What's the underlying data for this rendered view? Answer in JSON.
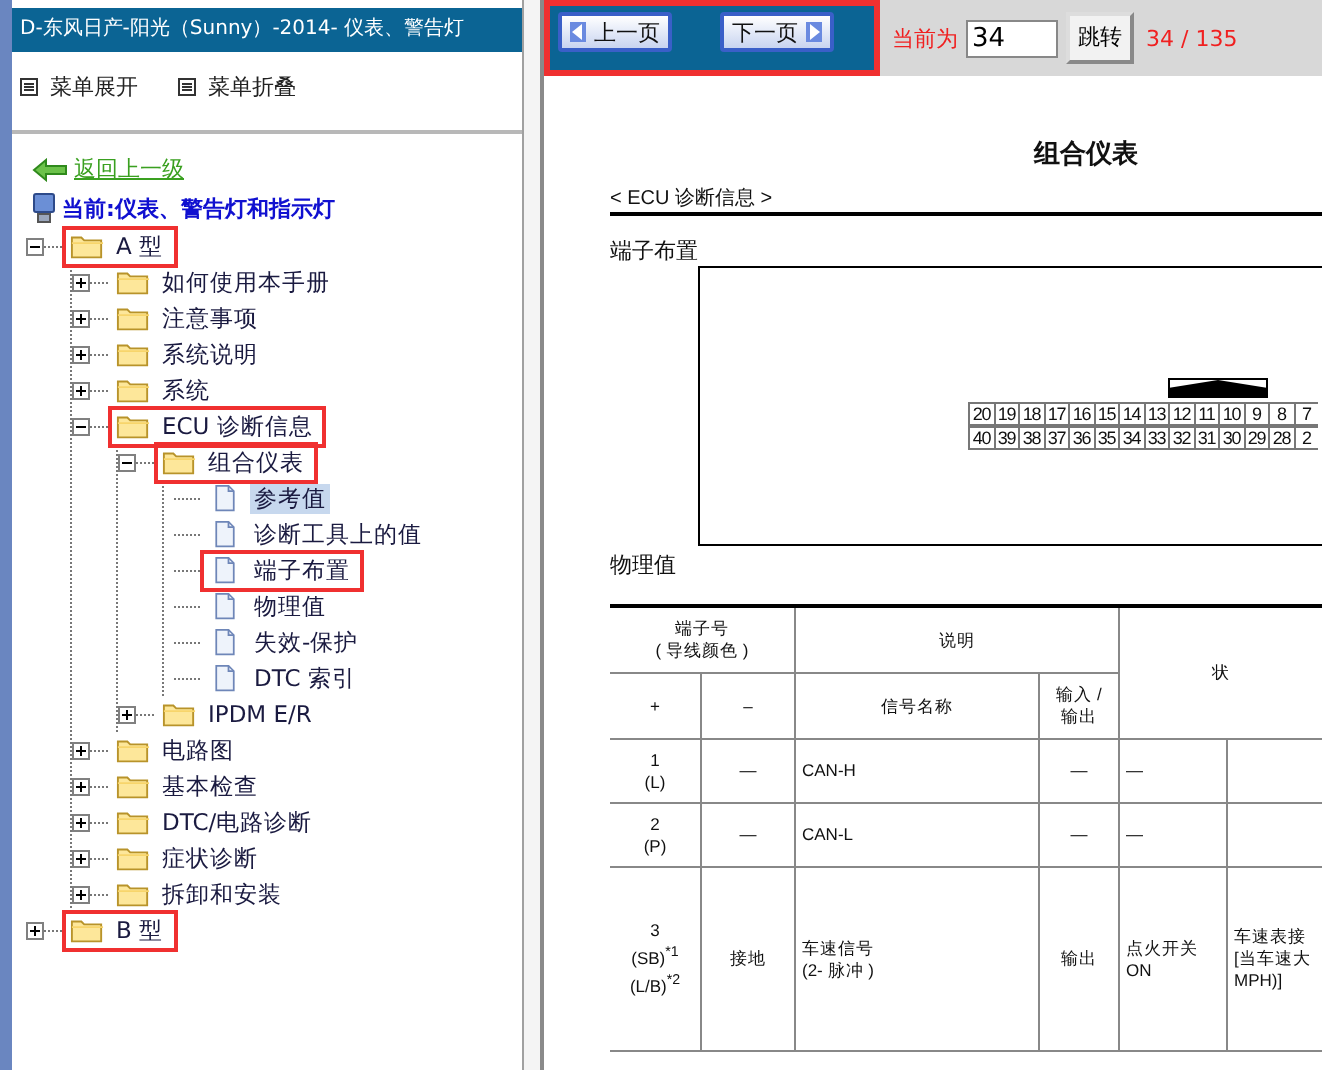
{
  "window": {
    "title": "D-东风日产-阳光（Sunny）-2014- 仪表、警告灯"
  },
  "menu_buttons": [
    "菜单展开",
    "菜单折叠"
  ],
  "back_link": "返回上一级",
  "current_path": "当前:仪表、警告灯和指示灯",
  "tree": [
    {
      "label": "A 型",
      "kind": "folder",
      "expanded": true,
      "selected": false,
      "highlighted": true,
      "children": [
        {
          "label": "如何使用本手册",
          "kind": "folder",
          "expanded": false,
          "selected": false,
          "highlighted": false
        },
        {
          "label": "注意事项",
          "kind": "folder",
          "expanded": false,
          "selected": false,
          "highlighted": false
        },
        {
          "label": "系统说明",
          "kind": "folder",
          "expanded": false,
          "selected": false,
          "highlighted": false
        },
        {
          "label": "系统",
          "kind": "folder",
          "expanded": false,
          "selected": false,
          "highlighted": false
        },
        {
          "label": "ECU 诊断信息",
          "kind": "folder",
          "expanded": true,
          "selected": false,
          "highlighted": true,
          "children": [
            {
              "label": "组合仪表",
              "kind": "folder",
              "expanded": true,
              "selected": false,
              "highlighted": true,
              "children": [
                {
                  "label": "参考值",
                  "kind": "page",
                  "selected": true,
                  "highlighted": false
                },
                {
                  "label": "诊断工具上的值",
                  "kind": "page",
                  "selected": false,
                  "highlighted": false
                },
                {
                  "label": "端子布置",
                  "kind": "page",
                  "selected": false,
                  "highlighted": true
                },
                {
                  "label": "物理值",
                  "kind": "page",
                  "selected": false,
                  "highlighted": false
                },
                {
                  "label": "失效-保护",
                  "kind": "page",
                  "selected": false,
                  "highlighted": false
                },
                {
                  "label": "DTC 索引",
                  "kind": "page",
                  "selected": false,
                  "highlighted": false
                }
              ]
            },
            {
              "label": "IPDM E/R",
              "kind": "folder",
              "expanded": false,
              "selected": false,
              "highlighted": false
            }
          ]
        },
        {
          "label": "电路图",
          "kind": "folder",
          "expanded": false,
          "selected": false,
          "highlighted": false
        },
        {
          "label": "基本检查",
          "kind": "folder",
          "expanded": false,
          "selected": false,
          "highlighted": false
        },
        {
          "label": "DTC/电路诊断",
          "kind": "folder",
          "expanded": false,
          "selected": false,
          "highlighted": false
        },
        {
          "label": "症状诊断",
          "kind": "folder",
          "expanded": false,
          "selected": false,
          "highlighted": false
        },
        {
          "label": "拆卸和安装",
          "kind": "folder",
          "expanded": false,
          "selected": false,
          "highlighted": false
        }
      ]
    },
    {
      "label": "B 型",
      "kind": "folder",
      "expanded": false,
      "selected": false,
      "highlighted": true
    }
  ],
  "pager": {
    "highlighted": true,
    "prev": "上一页",
    "next": "下一页",
    "current_label": "当前为",
    "page_input": "34",
    "go_button": "跳转",
    "page_count": "34 / 135"
  },
  "document": {
    "title": "组合仪表",
    "section": "< ECU 诊断信息 >",
    "connector_heading": "端子布置",
    "connector_pins": [
      [
        "20",
        "19",
        "18",
        "17",
        "16",
        "15",
        "14",
        "13",
        "12",
        "11",
        "10",
        "9",
        "8",
        "7"
      ],
      [
        "40",
        "39",
        "38",
        "37",
        "36",
        "35",
        "34",
        "33",
        "32",
        "31",
        "30",
        "29",
        "28",
        "2"
      ]
    ],
    "table_heading": "物理值",
    "table": {
      "group_headers": [
        "端子号\n( 导线颜色 )",
        "说明",
        "状"
      ],
      "columns": [
        "+",
        "–",
        "信号名称",
        "输入 / 输出"
      ],
      "rows": [
        [
          "1\n(L)",
          "—",
          "CAN-H",
          "—",
          "—",
          ""
        ],
        [
          "2\n(P)",
          "—",
          "CAN-L",
          "—",
          "—",
          ""
        ],
        [
          "3\n(SB)$^{*1}$\n(L/B)$^{*2}$",
          "接地",
          "车速信号\n(2- 脉冲 )",
          "输出",
          "点火开关\nON",
          "车速表接\n[当车速大\nMPH)]"
        ]
      ]
    }
  }
}
